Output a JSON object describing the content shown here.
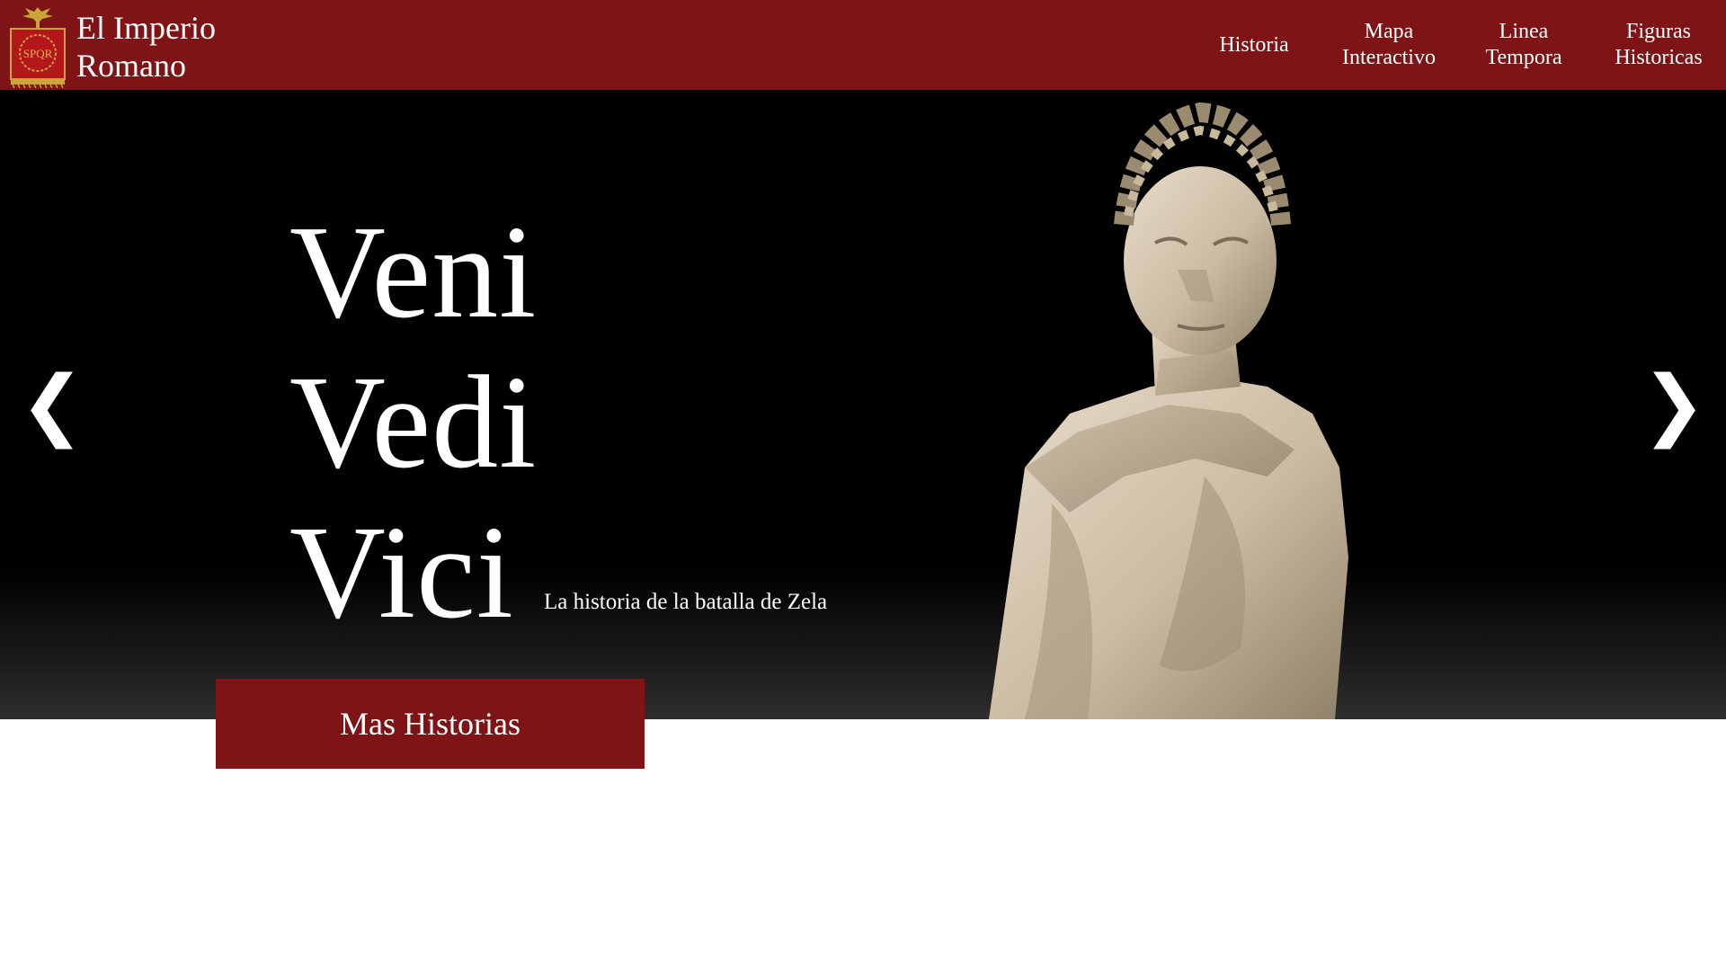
{
  "header": {
    "brand_line1": "El Imperio",
    "brand_line2": "Romano",
    "logo_text": "SPQR",
    "logo_icon": "spqr-eagle-emblem",
    "background": "#7e1416"
  },
  "nav": {
    "items": [
      {
        "line1": "Historia",
        "line2": ""
      },
      {
        "line1": "Mapa",
        "line2": "Interactivo"
      },
      {
        "line1": "Linea",
        "line2": "Tempora"
      },
      {
        "line1": "Figuras",
        "line2": "Historicas"
      }
    ]
  },
  "hero": {
    "motto": [
      "Veni",
      "Vedi",
      "Vici"
    ],
    "subtitle": "La historia de la batalla de Zela",
    "prev_arrow": "❮",
    "next_arrow": "❯",
    "image": "julius-caesar-statue"
  },
  "cta": {
    "label": "Mas Historias",
    "background": "#7e1416"
  }
}
